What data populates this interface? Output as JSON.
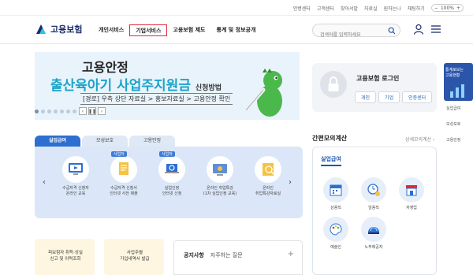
{
  "util_links": [
    "언병센터",
    "고객센터",
    "찾아서맡",
    "자료실",
    "원하는나",
    "채팅하기"
  ],
  "zoom_value": "100%",
  "logo": {
    "text": "고용보험"
  },
  "gnb": [
    {
      "label": "개인서비스",
      "active": false
    },
    {
      "label": "기업서비스",
      "active": true
    },
    {
      "label": "고용보험 제도",
      "active": false
    },
    {
      "label": "통계 및 정보공개",
      "active": false
    }
  ],
  "search": {
    "placeholder": "검색어를 입력하세요"
  },
  "banner": {
    "title": "고용안정",
    "headline": "출산육아기 사업주지원금",
    "headline_suffix": "신청방법",
    "path": "[경로] 우측 상단 자료실 > 홍보자료실 > 고용안정 확인"
  },
  "login": {
    "title": "고용보험 로그인",
    "buttons": [
      "개인",
      "기업",
      "인증센터"
    ]
  },
  "quick": {
    "box_text": [
      "통계로보는",
      "고용현황"
    ],
    "links": [
      "실업급여",
      "모성보호",
      "고용안정"
    ]
  },
  "tabs": [
    {
      "label": "실업급여",
      "active": true
    },
    {
      "label": "모성보호",
      "active": false
    },
    {
      "label": "고용안정",
      "active": false
    }
  ],
  "services": [
    {
      "label": [
        "수급자격 신청자",
        "온라인 교육"
      ],
      "badge": ""
    },
    {
      "label": [
        "수급자격 신청서",
        "인터넷 사전 제출"
      ],
      "badge": "사업자"
    },
    {
      "label": [
        "실업인정",
        "인터넷 신청"
      ],
      "badge": "사업자"
    },
    {
      "label": [
        "온라인 취업특강",
        "(1차 실업인정 교육)"
      ],
      "badge": ""
    },
    {
      "label": [
        "온라인",
        "취업특강자료실"
      ],
      "badge": ""
    }
  ],
  "calc": {
    "title": "간편모의계산",
    "more": "상세모의계산 ›",
    "tab": "실업급여",
    "items": [
      "상용직",
      "일용직",
      "자영업",
      "예술인",
      "노무제공자"
    ]
  },
  "bottom_cards": [
    {
      "text": [
        "피보험자 취득·상실",
        "신고 및 이력조회"
      ]
    },
    {
      "text": [
        "사업주별",
        "가입내역서 발급"
      ]
    }
  ],
  "notice": {
    "tabs": [
      "공지사항",
      "자주하는 질문"
    ],
    "plus": "+"
  },
  "colors": {
    "primary": "#2d6fd0",
    "brand": "#1b2d6b",
    "accent": "#1aa3c8",
    "highlight": "#e0283d"
  }
}
